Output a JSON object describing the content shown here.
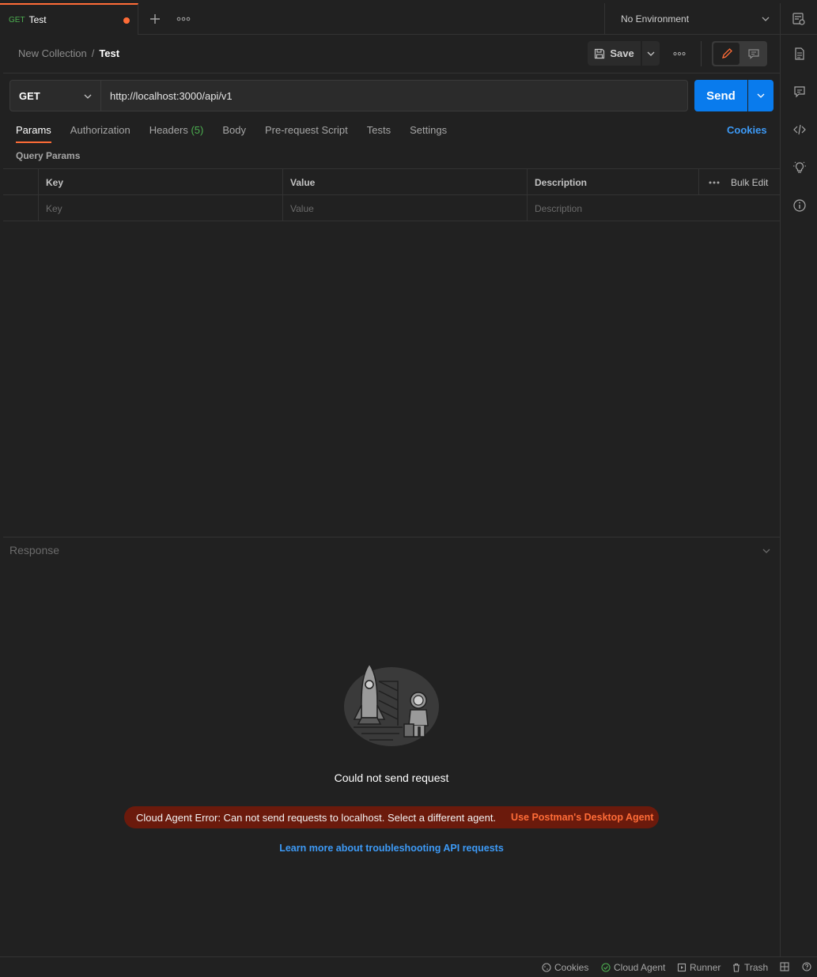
{
  "tab": {
    "method": "GET",
    "name": "Test"
  },
  "environment": {
    "selected": "No Environment"
  },
  "breadcrumb": {
    "collection": "New Collection",
    "separator": "/",
    "request": "Test"
  },
  "toolbar": {
    "save_label": "Save"
  },
  "request": {
    "method": "GET",
    "url": "http://localhost:3000/api/v1",
    "send_label": "Send"
  },
  "request_tabs": [
    {
      "label": "Params"
    },
    {
      "label": "Authorization"
    },
    {
      "label": "Headers",
      "count": "(5)"
    },
    {
      "label": "Body"
    },
    {
      "label": "Pre-request Script"
    },
    {
      "label": "Tests"
    },
    {
      "label": "Settings"
    }
  ],
  "cookies_label": "Cookies",
  "query_params": {
    "title": "Query Params",
    "headers": {
      "key": "Key",
      "value": "Value",
      "description": "Description",
      "bulk_edit": "Bulk Edit"
    },
    "placeholders": {
      "key": "Key",
      "value": "Value",
      "description": "Description"
    }
  },
  "response": {
    "label": "Response",
    "error_title": "Could not send request",
    "error_message": "Cloud Agent Error: Can not send requests to localhost. Select a different agent.",
    "error_action": "Use Postman's Desktop Agent",
    "learn_more": "Learn more about troubleshooting API requests"
  },
  "footer": {
    "cookies": "Cookies",
    "agent": "Cloud Agent",
    "runner": "Runner",
    "trash": "Trash"
  },
  "colors": {
    "accent": "#ff6c37",
    "send": "#097bed",
    "link": "#3d9af6",
    "get_method": "#4caf50",
    "error_bg": "#6b1a0c"
  }
}
